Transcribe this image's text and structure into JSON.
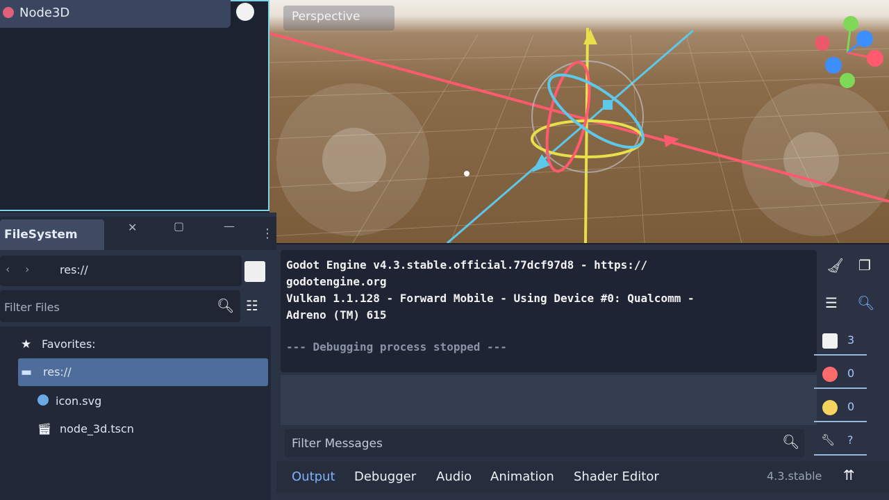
{
  "scene": {
    "root_node": "Node3D"
  },
  "viewport": {
    "menu_label": "Perspective"
  },
  "filesystem": {
    "tab_label": "FileSystem",
    "path": "res://",
    "filter_placeholder": "Filter Files",
    "tree": [
      {
        "label": "Favorites:",
        "icon": "star-icon"
      },
      {
        "label": "res://",
        "icon": "folder-icon",
        "selected": true
      },
      {
        "label": "icon.svg",
        "icon": "image-icon"
      },
      {
        "label": "node_3d.tscn",
        "icon": "scene-icon"
      }
    ]
  },
  "output": {
    "lines": [
      "Godot Engine v4.3.stable.official.77dcf97d8 - https://",
      "godotengine.org",
      "Vulkan 1.1.128 - Forward Mobile - Using Device #0: Qualcomm -",
      "Adreno (TM) 615"
    ],
    "status_line": "--- Debugging process stopped ---",
    "filter_placeholder": "Filter Messages",
    "counts": {
      "messages": "3",
      "errors": "0",
      "warnings": "0",
      "editor": "?"
    }
  },
  "bottom_tabs": [
    "Output",
    "Debugger",
    "Audio",
    "Animation",
    "Shader Editor"
  ],
  "version": "4.3.stable",
  "colors": {
    "selection_outline": "#7ad6e6",
    "accent": "#7fb3ff",
    "x_axis": "#ff5a6e",
    "y_axis": "#e8e04a",
    "z_axis": "#5ec8ea"
  }
}
